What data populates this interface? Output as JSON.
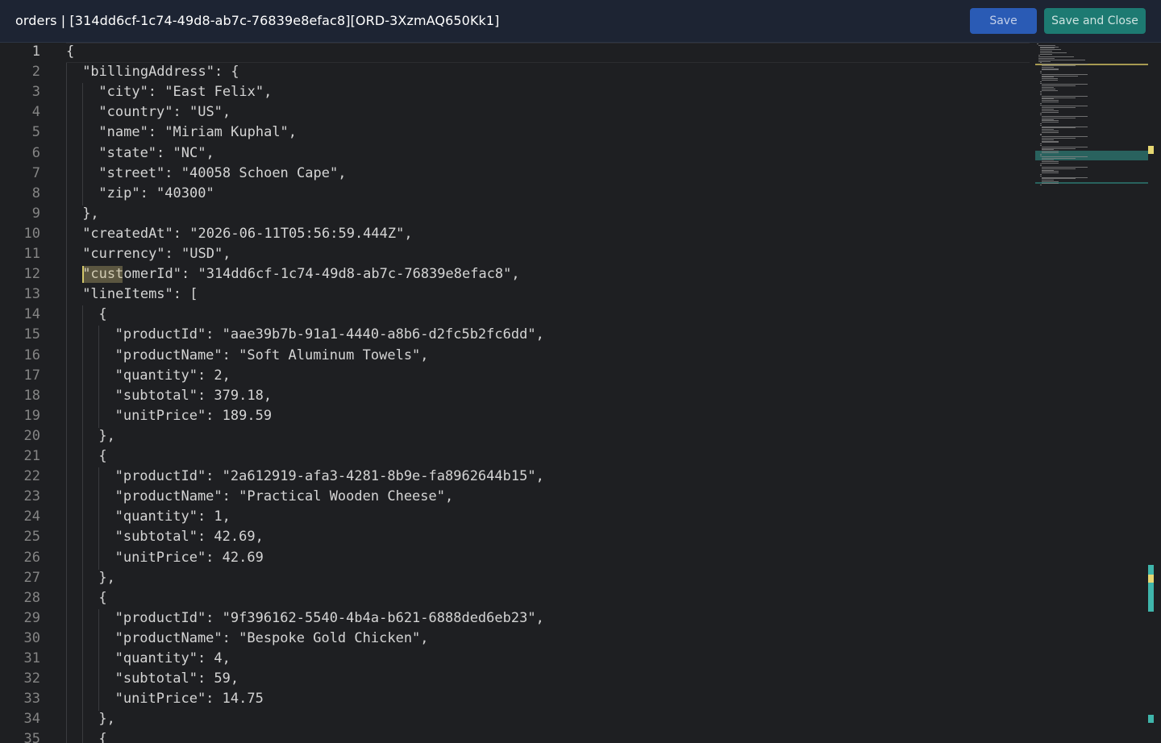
{
  "window": {
    "title": "orders | [314dd6cf-1c74-49d8-ab7c-76839e8efac8][ORD-3XzmAQ650Kk1]"
  },
  "toolbar": {
    "save_label": "Save",
    "save_close_label": "Save and Close"
  },
  "colors": {
    "header_bg": "#1d2433",
    "save_button": "#2a5bb5",
    "save_close_button": "#1d7a72",
    "editor_bg": "#1e1f22",
    "find_highlight": "#cdbe78",
    "scroll_marker_teal": "#3fb5ab",
    "scroll_marker_yellow": "#e6d772"
  },
  "editor": {
    "active_line": 1,
    "cursor_line": 12,
    "lines": [
      {
        "n": "1",
        "indent": 0,
        "text": "{"
      },
      {
        "n": "2",
        "indent": 1,
        "text": "\"billingAddress\": {"
      },
      {
        "n": "3",
        "indent": 2,
        "text": "\"city\": \"East Felix\","
      },
      {
        "n": "4",
        "indent": 2,
        "text": "\"country\": \"US\","
      },
      {
        "n": "5",
        "indent": 2,
        "text": "\"name\": \"Miriam Kuphal\","
      },
      {
        "n": "6",
        "indent": 2,
        "text": "\"state\": \"NC\","
      },
      {
        "n": "7",
        "indent": 2,
        "text": "\"street\": \"40058 Schoen Cape\","
      },
      {
        "n": "8",
        "indent": 2,
        "text": "\"zip\": \"40300\""
      },
      {
        "n": "9",
        "indent": 1,
        "text": "},"
      },
      {
        "n": "10",
        "indent": 1,
        "text": "\"createdAt\": \"2026-06-11T05:56:59.444Z\","
      },
      {
        "n": "11",
        "indent": 1,
        "text": "\"currency\": \"USD\","
      },
      {
        "n": "12",
        "indent": 1,
        "text": "\"customerId\": \"314dd6cf-1c74-49d8-ab7c-76839e8efac8\","
      },
      {
        "n": "13",
        "indent": 1,
        "text": "\"lineItems\": ["
      },
      {
        "n": "14",
        "indent": 2,
        "text": "{"
      },
      {
        "n": "15",
        "indent": 3,
        "text": "\"productId\": \"aae39b7b-91a1-4440-a8b6-d2fc5b2fc6dd\","
      },
      {
        "n": "16",
        "indent": 3,
        "text": "\"productName\": \"Soft Aluminum Towels\","
      },
      {
        "n": "17",
        "indent": 3,
        "text": "\"quantity\": 2,"
      },
      {
        "n": "18",
        "indent": 3,
        "text": "\"subtotal\": 379.18,"
      },
      {
        "n": "19",
        "indent": 3,
        "text": "\"unitPrice\": 189.59"
      },
      {
        "n": "20",
        "indent": 2,
        "text": "},"
      },
      {
        "n": "21",
        "indent": 2,
        "text": "{"
      },
      {
        "n": "22",
        "indent": 3,
        "text": "\"productId\": \"2a612919-afa3-4281-8b9e-fa8962644b15\","
      },
      {
        "n": "23",
        "indent": 3,
        "text": "\"productName\": \"Practical Wooden Cheese\","
      },
      {
        "n": "24",
        "indent": 3,
        "text": "\"quantity\": 1,"
      },
      {
        "n": "25",
        "indent": 3,
        "text": "\"subtotal\": 42.69,"
      },
      {
        "n": "26",
        "indent": 3,
        "text": "\"unitPrice\": 42.69"
      },
      {
        "n": "27",
        "indent": 2,
        "text": "},"
      },
      {
        "n": "28",
        "indent": 2,
        "text": "{"
      },
      {
        "n": "29",
        "indent": 3,
        "text": "\"productId\": \"9f396162-5540-4b4a-b621-6888ded6eb23\","
      },
      {
        "n": "30",
        "indent": 3,
        "text": "\"productName\": \"Bespoke Gold Chicken\","
      },
      {
        "n": "31",
        "indent": 3,
        "text": "\"quantity\": 4,"
      },
      {
        "n": "32",
        "indent": 3,
        "text": "\"subtotal\": 59,"
      },
      {
        "n": "33",
        "indent": 3,
        "text": "\"unitPrice\": 14.75"
      },
      {
        "n": "34",
        "indent": 2,
        "text": "},"
      },
      {
        "n": "35",
        "indent": 2,
        "text": "{"
      }
    ]
  }
}
